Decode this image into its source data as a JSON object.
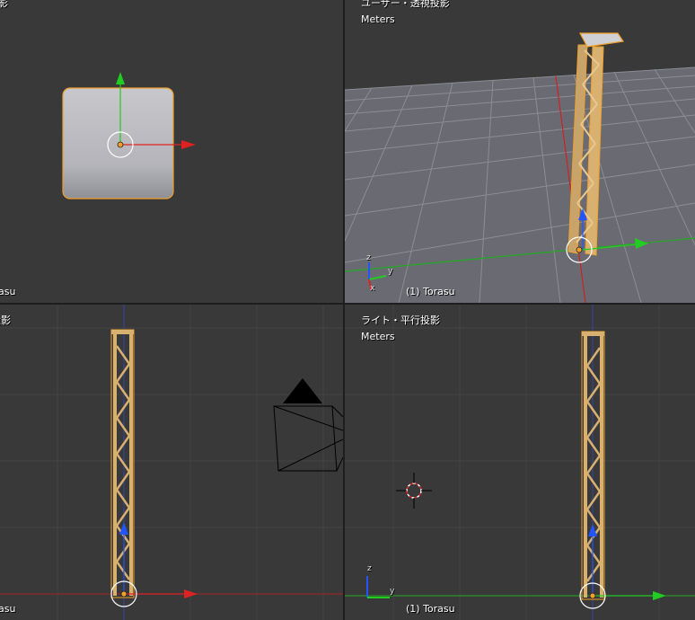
{
  "viewports": {
    "top_left": {
      "view_title": "影",
      "object_label": "asu"
    },
    "top_right": {
      "view_title": "ユーザー・透視投影",
      "units": "Meters",
      "object_label": "(1) Torasu",
      "axes": {
        "z": "z",
        "x": "x",
        "y": "y"
      }
    },
    "bottom_left": {
      "view_title": "投影",
      "object_label": "asu"
    },
    "bottom_right": {
      "view_title": "ライト・平行投影",
      "units": "Meters",
      "object_label": "(1) Torasu",
      "axes": {
        "z": "z",
        "y": "y"
      }
    }
  },
  "colors": {
    "viewport_bg": "#393939",
    "grid": "#444444",
    "selection": "#f0a028",
    "truss": "#d8b070",
    "axis_x": "#dd2222",
    "axis_y": "#22cc22",
    "axis_z": "#2255ff"
  }
}
